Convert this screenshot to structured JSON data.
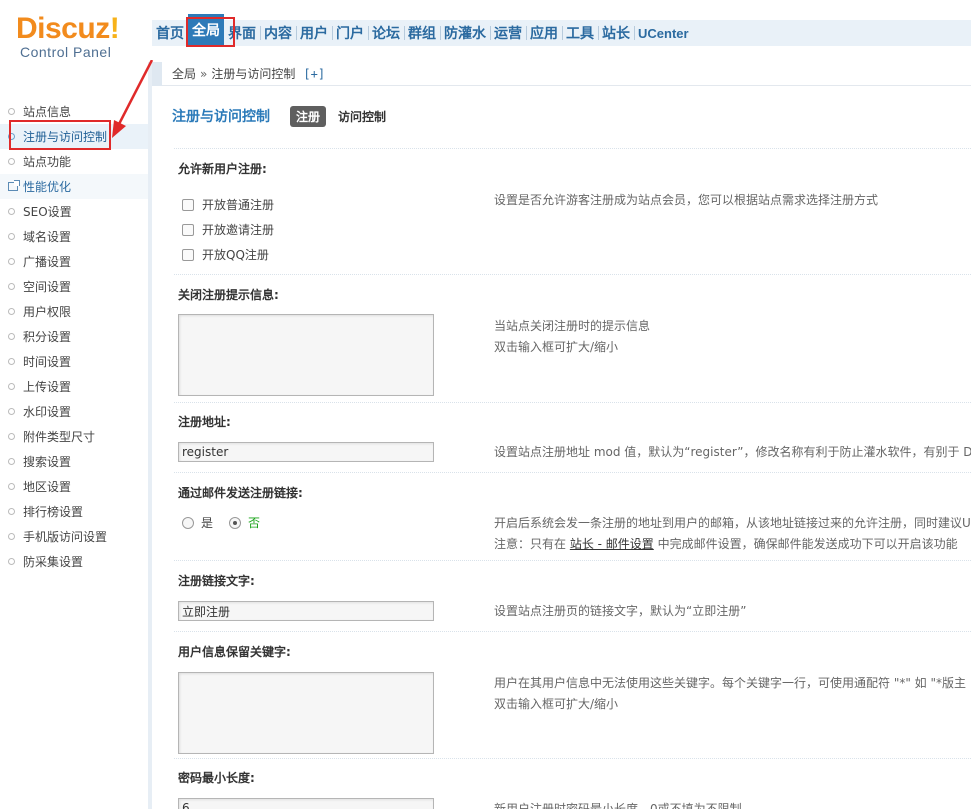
{
  "logo": {
    "main": "Discuz",
    "bang": "!",
    "sub": "Control Panel"
  },
  "topnav": {
    "items": [
      "首页",
      "全局",
      "界面",
      "内容",
      "用户",
      "门户",
      "论坛",
      "群组",
      "防灌水",
      "运营",
      "应用",
      "工具",
      "站长",
      "UCenter"
    ],
    "active_index": 1
  },
  "breadcrumb": {
    "root": "全局",
    "sep": "»",
    "current": "注册与访问控制",
    "plus": "[+]"
  },
  "sidebar": {
    "items": [
      "站点信息",
      "注册与访问控制",
      "站点功能",
      "性能优化",
      "SEO设置",
      "域名设置",
      "广播设置",
      "空间设置",
      "用户权限",
      "积分设置",
      "时间设置",
      "上传设置",
      "水印设置",
      "附件类型尺寸",
      "搜索设置",
      "地区设置",
      "排行榜设置",
      "手机版访问设置",
      "防采集设置"
    ],
    "current_index": 1
  },
  "main": {
    "title": "注册与访问控制",
    "tabs": [
      "注册",
      "访问控制"
    ],
    "fields": {
      "allow_register": {
        "label": "允许新用户注册:",
        "options": [
          "开放普通注册",
          "开放邀请注册",
          "开放QQ注册"
        ],
        "hint": "设置是否允许游客注册成为站点会员，您可以根据站点需求选择注册方式"
      },
      "close_msg": {
        "label": "关闭注册提示信息:",
        "value": "",
        "hint1": "当站点关闭注册时的提示信息",
        "hint2": "双击输入框可扩大/缩小"
      },
      "reg_url": {
        "label": "注册地址:",
        "value": "register",
        "hint": "设置站点注册地址 mod 值，默认为“register”，修改名称有利于防止灌水软件，有别于 D"
      },
      "email_link": {
        "label": "通过邮件发送注册链接:",
        "yes": "是",
        "no": "否",
        "hint1": "开启后系统会发一条注册的地址到用户的邮箱，从该地址链接过来的允许注册，同时建议U",
        "hint2_pre": "注意：只有在 ",
        "hint2_link": "站长 - 邮件设置",
        "hint2_post": " 中完成邮件设置，确保邮件能发送成功下可以开启该功能"
      },
      "reg_link_text": {
        "label": "注册链接文字:",
        "value": "立即注册",
        "hint": "设置站点注册页的链接文字，默认为“立即注册”"
      },
      "censor_user": {
        "label": "用户信息保留关键字:",
        "value": "",
        "hint1": "用户在其用户信息中无法使用这些关键字。每个关键字一行，可使用通配符 \"*\" 如 \"*版主",
        "hint2": "双击输入框可扩大/缩小"
      },
      "pwd_length": {
        "label": "密码最小长度:",
        "value": "6",
        "hint": "新用户注册时密码最小长度，0或不填为不限制"
      }
    }
  }
}
